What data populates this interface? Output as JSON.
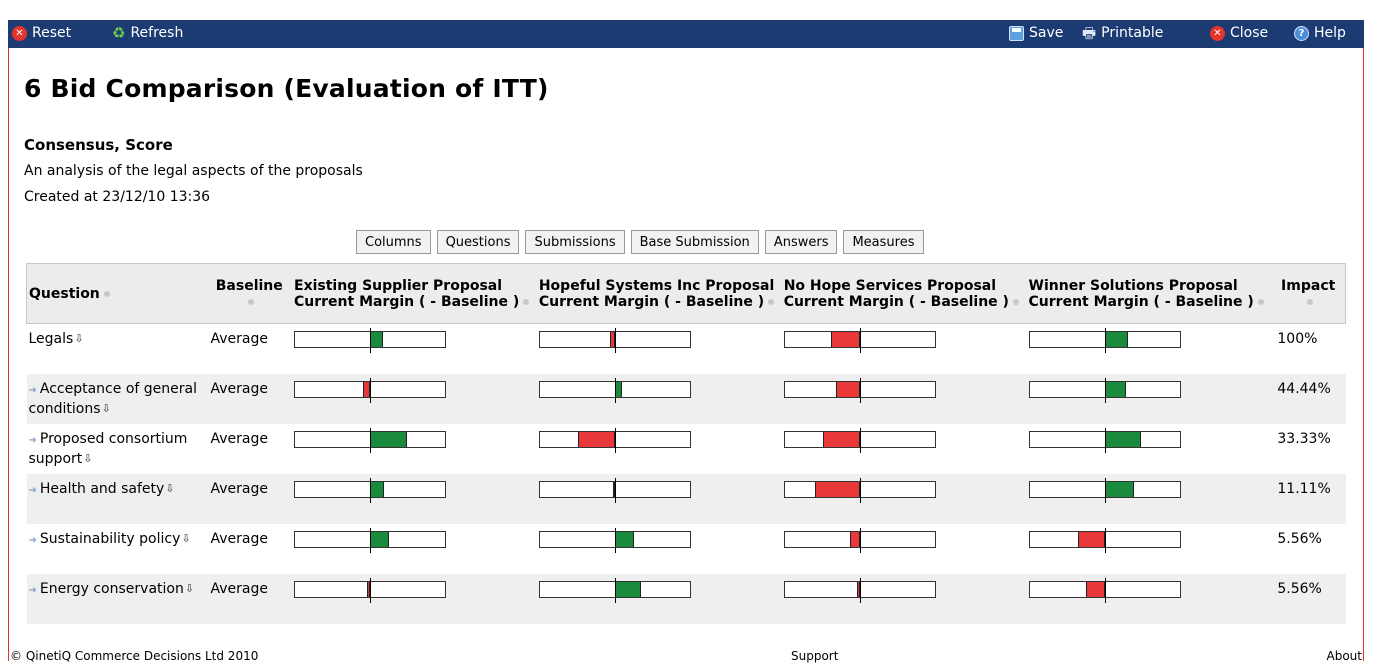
{
  "toolbar": {
    "reset": "Reset",
    "refresh": "Refresh",
    "save": "Save",
    "printable": "Printable",
    "close": "Close",
    "help": "Help"
  },
  "page": {
    "title": "6 Bid Comparison (Evaluation of ITT)",
    "subtitle": "Consensus, Score",
    "description": "An analysis of the legal aspects of the proposals",
    "created": "Created at 23/12/10 13:36"
  },
  "buttons": [
    "Columns",
    "Questions",
    "Submissions",
    "Base Submission",
    "Answers",
    "Measures"
  ],
  "table": {
    "headers": {
      "question": "Question",
      "baseline": "Baseline",
      "col1": "Existing Supplier Proposal Current Margin ( - Baseline )",
      "col2": "Hopeful Systems Inc Proposal Current Margin ( - Baseline )",
      "col3": "No Hope Services Proposal Current Margin ( - Baseline )",
      "col4": "Winner Solutions Proposal Current Margin ( - Baseline )",
      "impact": "Impact"
    },
    "rows": [
      {
        "question": "Legals",
        "indent": false,
        "baseline": "Average",
        "impact": "100%",
        "margins": [
          0.17,
          -0.07,
          -0.38,
          0.31
        ]
      },
      {
        "question": "Acceptance of general conditions",
        "indent": true,
        "baseline": "Average",
        "impact": "44.44%",
        "margins": [
          -0.1,
          0.1,
          -0.31,
          0.29
        ]
      },
      {
        "question": "Proposed consortium support",
        "indent": true,
        "baseline": "Average",
        "impact": "33.33%",
        "margins": [
          0.49,
          -0.49,
          -0.49,
          0.49
        ]
      },
      {
        "question": "Health and safety",
        "indent": true,
        "baseline": "Average",
        "impact": "11.11%",
        "margins": [
          0.19,
          -0.02,
          -0.6,
          0.39
        ]
      },
      {
        "question": "Sustainability policy",
        "indent": true,
        "baseline": "Average",
        "impact": "5.56%",
        "margins": [
          0.25,
          0.25,
          -0.13,
          -0.35
        ]
      },
      {
        "question": "Energy conservation",
        "indent": true,
        "baseline": "Average",
        "impact": "5.56%",
        "margins": [
          -0.04,
          0.35,
          -0.04,
          -0.25
        ]
      }
    ]
  },
  "colors": {
    "positive": "#1a8a3c",
    "negative": "#e8383a",
    "neutral": "#a8a24a",
    "header_bar": "#1d3b73"
  },
  "footer": {
    "copyright": "© QinetiQ Commerce Decisions Ltd 2010",
    "support": "Support",
    "about": "About"
  }
}
